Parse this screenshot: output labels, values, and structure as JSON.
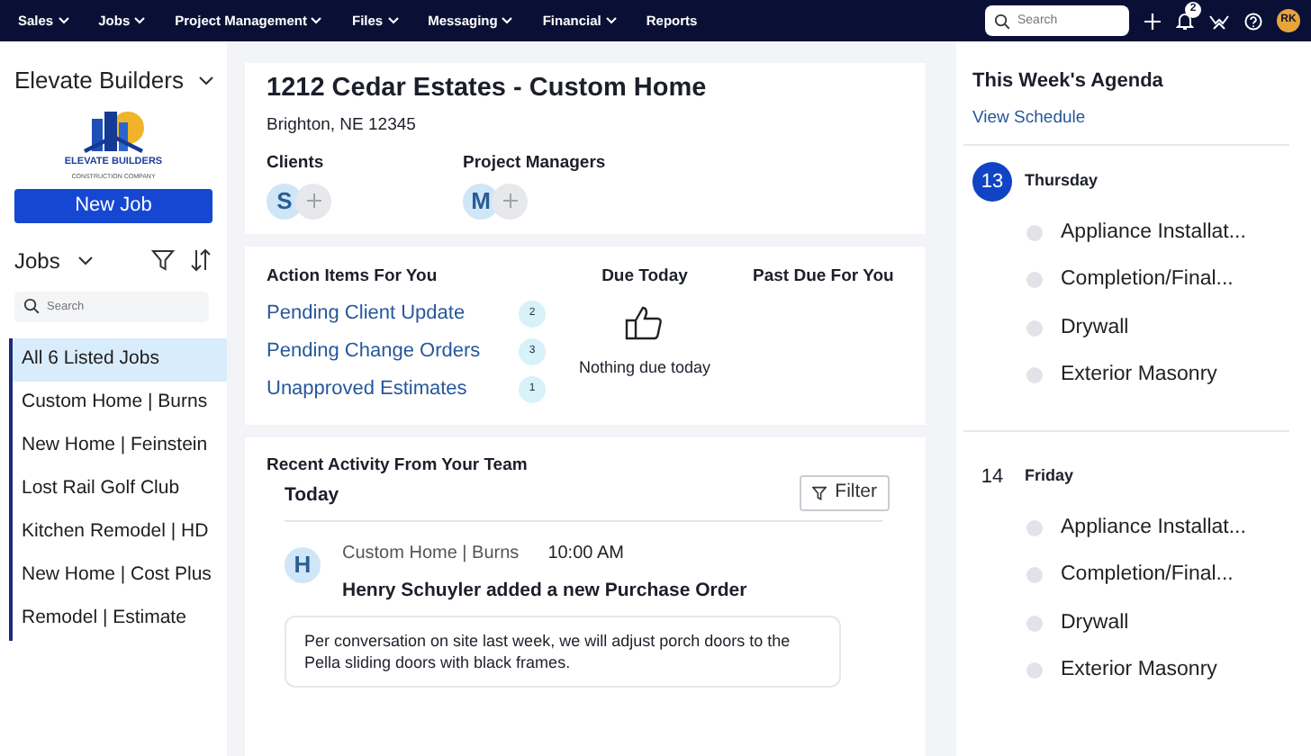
{
  "topnav": {
    "menus": [
      {
        "label": "Sales",
        "dropdown": true
      },
      {
        "label": "Jobs",
        "dropdown": true
      },
      {
        "label": "Project Management",
        "dropdown": true
      },
      {
        "label": "Files",
        "dropdown": true
      },
      {
        "label": "Messaging",
        "dropdown": true
      },
      {
        "label": "Financial",
        "dropdown": true
      },
      {
        "label": "Reports",
        "dropdown": false
      }
    ],
    "search": {
      "placeholder": "Search"
    },
    "notification_count": "2",
    "avatar": "RK"
  },
  "sidebar": {
    "company": "Elevate Builders",
    "logo": {
      "name": "ELEVATE BUILDERS",
      "tagline": "CONSTRUCTION COMPANY"
    },
    "new_job_button": "New Job",
    "jobs_label": "Jobs",
    "search": {
      "placeholder": "Search"
    },
    "jobs": [
      {
        "label": "All 6 Listed Jobs",
        "selected": true
      },
      {
        "label": "Custom Home | Burns",
        "selected": false
      },
      {
        "label": "New Home | Feinstein",
        "selected": false
      },
      {
        "label": "Lost Rail Golf Club",
        "selected": false
      },
      {
        "label": "Kitchen Remodel | HD",
        "selected": false
      },
      {
        "label": "New Home | Cost Plus",
        "selected": false
      },
      {
        "label": "Remodel | Estimate",
        "selected": false
      }
    ]
  },
  "job": {
    "title": "1212 Cedar Estates - Custom Home",
    "address": "Brighton, NE 12345",
    "people": [
      {
        "label": "Clients",
        "initial": "S"
      },
      {
        "label": "Project Managers",
        "initial": "M"
      }
    ]
  },
  "action_items": {
    "title": "Action Items For You",
    "items": [
      {
        "label": "Pending Client Update",
        "count": "2"
      },
      {
        "label": "Pending Change Orders",
        "count": "3"
      },
      {
        "label": "Unapproved Estimates",
        "count": "1"
      }
    ],
    "due_today": {
      "title": "Due Today",
      "message": "Nothing due today"
    },
    "past_due": {
      "title": "Past Due For You"
    }
  },
  "activity": {
    "title": "Recent Activity From Your Team",
    "filter_button": "Filter",
    "day": "Today",
    "entries": [
      {
        "initial": "H",
        "job": "Custom Home | Burns",
        "time": "10:00 AM",
        "headline": "Henry Schuyler added a new Purchase Order",
        "note": "Per conversation on site last week, we will adjust porch doors to the Pella sliding doors with black frames."
      }
    ]
  },
  "agenda": {
    "title": "This Week's Agenda",
    "link": "View Schedule",
    "days": [
      {
        "date": "13",
        "weekday": "Thursday",
        "selected": true,
        "items": [
          "Appliance Installat...",
          "Completion/Final...",
          "Drywall",
          "Exterior Masonry"
        ]
      },
      {
        "date": "14",
        "weekday": "Friday",
        "selected": false,
        "items": [
          "Appliance Installat...",
          "Completion/Final...",
          "Drywall",
          "Exterior Masonry"
        ]
      }
    ]
  }
}
